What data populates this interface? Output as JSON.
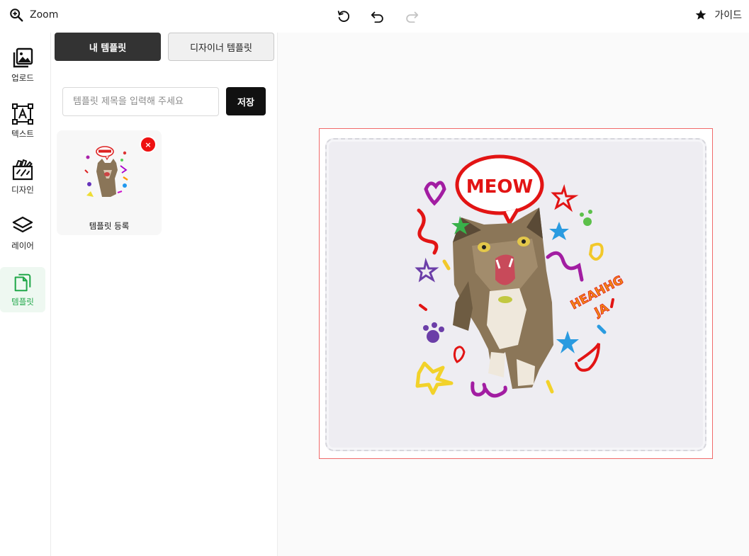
{
  "topbar": {
    "zoom_label": "Zoom",
    "guide_label": "가이드",
    "icons": [
      "zoom-in-icon",
      "reset-icon",
      "undo-icon",
      "redo-icon",
      "star-icon"
    ]
  },
  "rail": {
    "items": [
      {
        "id": "upload",
        "label": "업로드",
        "icon": "image-gallery-icon"
      },
      {
        "id": "text",
        "label": "텍스트",
        "icon": "text-frame-icon"
      },
      {
        "id": "design",
        "label": "디자인",
        "icon": "design-folder-icon"
      },
      {
        "id": "layer",
        "label": "레이어",
        "icon": "layers-icon"
      },
      {
        "id": "template",
        "label": "템플릿",
        "icon": "template-document-icon",
        "active": true
      }
    ]
  },
  "panel": {
    "tabs": {
      "mine": "내 템플릿",
      "designer": "디자이너 템플릿"
    },
    "title_input": {
      "placeholder": "템플릿 제목을 입력해 주세요",
      "value": ""
    },
    "save_label": "저장",
    "templates": [
      {
        "label": "템플릿 등록",
        "delete_label": "×"
      }
    ]
  },
  "canvas": {
    "speech_text": "MEOW",
    "side_text_1": "HEAHHG",
    "side_text_2": "JA",
    "colors": {
      "artboard_border": "#f06a6a",
      "active_accent": "#22a84a",
      "delete": "#ee1111"
    }
  }
}
